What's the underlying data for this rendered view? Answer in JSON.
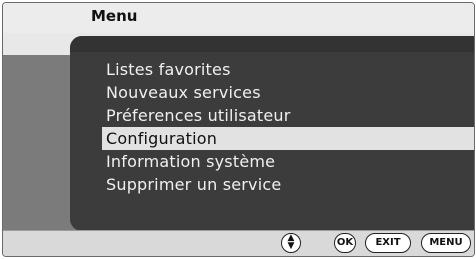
{
  "menu": {
    "title": "Menu",
    "items": [
      {
        "label": "Listes favorites",
        "selected": false
      },
      {
        "label": "Nouveaux services",
        "selected": false
      },
      {
        "label": "Préferences utilisateur",
        "selected": false
      },
      {
        "label": "Configuration",
        "selected": true
      },
      {
        "label": "Information système",
        "selected": false
      },
      {
        "label": "Supprimer un service",
        "selected": false
      }
    ]
  },
  "footer": {
    "nav_icon": "up-down-arrows-icon",
    "ok_label": "OK",
    "exit_label": "EXIT",
    "menu_label": "MENU"
  }
}
